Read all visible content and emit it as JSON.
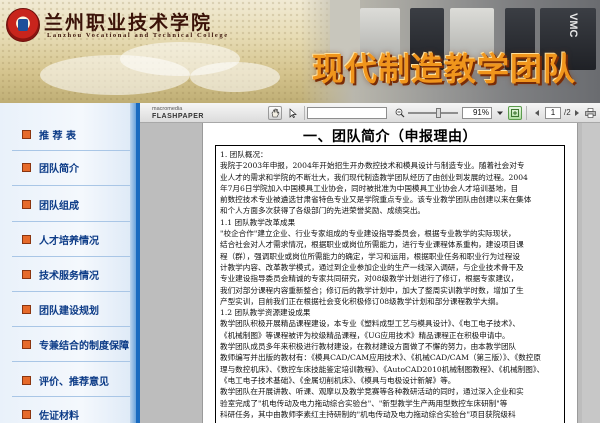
{
  "banner": {
    "school_name_cn": "兰州职业技术学院",
    "school_name_en": "Lanzhou  Vocational and Technical College",
    "title": "现代制造教学团队",
    "machine_text": "VMC"
  },
  "sidebar": {
    "items": [
      {
        "label": "推 荐 表"
      },
      {
        "label": "团队简介"
      },
      {
        "label": "团队组成"
      },
      {
        "label": "人才培养情况"
      },
      {
        "label": "技术服务情况"
      },
      {
        "label": "团队建设规划"
      },
      {
        "label": "专兼结合的制度保障"
      },
      {
        "label": "评价、推荐意见"
      },
      {
        "label": "佐证材料"
      }
    ]
  },
  "toolbar": {
    "brand_top": "macromedia",
    "brand_bottom": "FLASHPAPER",
    "zoom_value": "91%",
    "page_current": "1",
    "page_total": "/2",
    "icons": [
      "hand-tool",
      "select-tool",
      "zoom-out",
      "zoom-in",
      "fit-width",
      "prev-page",
      "next-page",
      "print"
    ]
  },
  "document": {
    "title": "一、团队简介（申报理由）",
    "lines": [
      "1. 团队概况：",
      "我院于2003年申报，2004年开始招生开办数控技术和模具设计与制造专业。随着社会对专",
      "业人才的需求和学院的不断壮大，我们现代制造教学团队经历了由创业到发展的过程。2004",
      "年7月6日学院加入中国模具工业协会，同时被批准为中国模具工业协会人才培训基地，目",
      "前数控技术专业被遴选甘肃省特色专业又是学院重点专业。该专业教学团队由创建以来在集体",
      "和个人方面多次获得了各级部门的先进荣誉奖励、成绩突出。",
      "1.1 团队教学改革成果",
      "\"校企合作\"建立企业、行业专家组成的专业建设指导委员会，根据专业教学的实际现状，",
      "结合社会对人才需求情况，根据职业或岗位所需能力，进行专业课程体系重构，建设项目课",
      "程（群），强调职业或岗位所需能力的确定，学习和运用，根据职业任务和职业行为过程设",
      "计教学内容、改革教学模式，通过到企业参加企业的生产一线深入调研，与企业技术骨干及",
      "专业建设指导委员会精诚的专家共同研究，对08级教学计划进行了修订，根据专家建议，",
      "我们对部分课程内容重新整合；修订后的教学计划中，加大了整周实训教学时数，增加了生",
      "产型实训，目前我们正在根据社会变化积极修订08级教学计划和部分课程教学大纲。",
      "1.2 团队教学资源建设成果",
      "教学团队积极开展精品课程建设，本专业《塑料成型工艺与模具设计》、《电工电子技术》、",
      "《机械制图》等课程被评为校级精品课程，《UG应用技术》精品课程正在积极申请中。",
      "教学团队成员多年来积极进行教材建设，在教材建设方面做了不懈的努力，由本教学团队",
      "教师编写并出版的教材有：《模具CAD/CAM应用技术》、《机械CAD/CAM（第三版）》、《数控原",
      "理与数控机床》、《数控车床技能鉴定培训教程》、《AutoCAD2010机械制图教程》、《机械制图》、",
      "《电工电子技术基础》、《金属切削机床》、《模具与电极设计新解》等。",
      "教学团队在开展讲教、听课、观摩以及教学竞赛等各种教研活动的同时，通过深入企业和实",
      "验室完成了\"机电传动及电力拖动综合实验台\"、\"新型教学生产两用型数控车床研制\"等",
      "科研任务，其中由教师李素红主持研制的\"机电传动及电力拖动综合实验台\"项目获院级科"
    ]
  }
}
